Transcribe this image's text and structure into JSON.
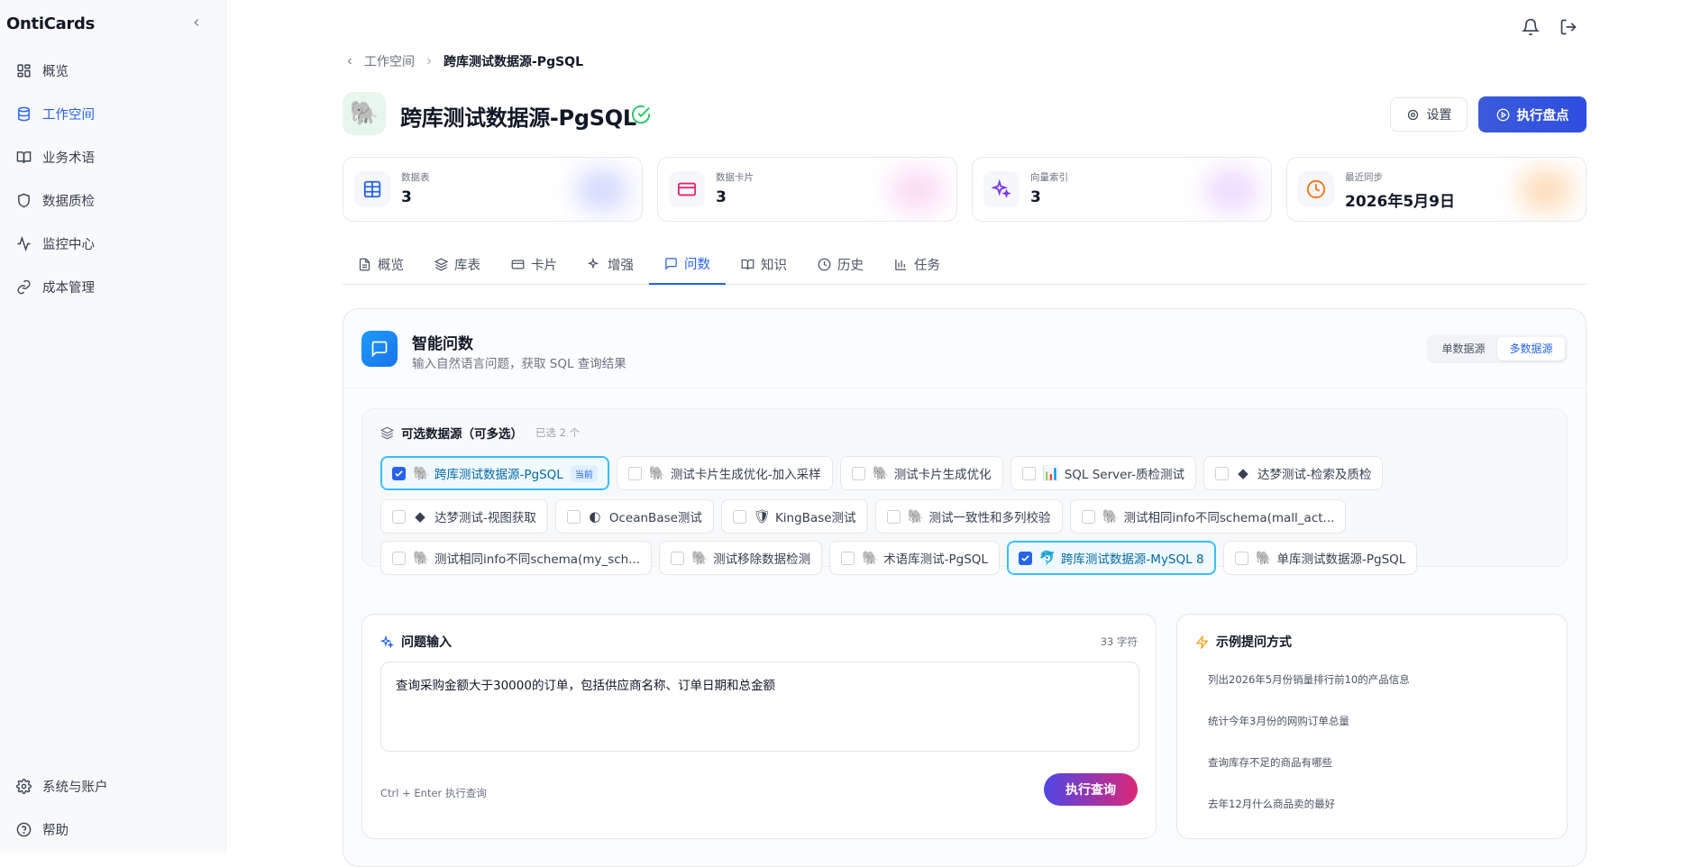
{
  "app": {
    "brand": "OntiCards"
  },
  "sidebar": {
    "items": [
      {
        "label": "概览",
        "icon": "grid-icon"
      },
      {
        "label": "工作空间",
        "icon": "database-icon",
        "active": true
      },
      {
        "label": "业务术语",
        "icon": "book-icon"
      },
      {
        "label": "数据质检",
        "icon": "shield-icon"
      },
      {
        "label": "监控中心",
        "icon": "activity-icon"
      },
      {
        "label": "成本管理",
        "icon": "link-icon"
      }
    ],
    "bottom": [
      {
        "label": "系统与账户",
        "icon": "gear-icon"
      },
      {
        "label": "帮助",
        "icon": "help-icon"
      }
    ]
  },
  "breadcrumb": {
    "parent": "工作空间",
    "current": "跨库测试数据源-PgSQL"
  },
  "header": {
    "title": "跨库测试数据源-PgSQL",
    "settings_label": "设置",
    "run_label": "执行盘点"
  },
  "stats": [
    {
      "label": "数据表",
      "value": "3",
      "color": "#2563eb",
      "icon": "table-icon"
    },
    {
      "label": "数据卡片",
      "value": "3",
      "color": "#db2777",
      "icon": "card-icon"
    },
    {
      "label": "向量索引",
      "value": "3",
      "color": "#7c3aed",
      "icon": "sparkle-icon"
    },
    {
      "label": "最近同步",
      "value": "2026年5月9日",
      "color": "#f97316",
      "icon": "clock-icon"
    }
  ],
  "tabs": [
    {
      "label": "概览",
      "icon": "file-icon"
    },
    {
      "label": "库表",
      "icon": "layers-icon"
    },
    {
      "label": "卡片",
      "icon": "card-icon"
    },
    {
      "label": "增强",
      "icon": "sparkle-icon"
    },
    {
      "label": "问数",
      "icon": "chat-icon",
      "active": true
    },
    {
      "label": "知识",
      "icon": "book-icon"
    },
    {
      "label": "历史",
      "icon": "clock-icon"
    },
    {
      "label": "任务",
      "icon": "chart-icon"
    }
  ],
  "ask": {
    "title": "智能问数",
    "subtitle": "输入自然语言问题，获取 SQL 查询结果",
    "mode_single": "单数据源",
    "mode_multi": "多数据源",
    "sources_title": "可选数据源（可多选）",
    "sources_count": "已选 2 个",
    "current_tag": "当前",
    "sources": [
      [
        {
          "label": "跨库测试数据源-PgSQL",
          "selected": true,
          "current": true,
          "icon": "🐘"
        },
        {
          "label": "测试卡片生成优化-加入采样",
          "icon": "🐘"
        },
        {
          "label": "测试卡片生成优化",
          "icon": "🐘"
        },
        {
          "label": "SQL Server-质检测试",
          "icon": "📊"
        },
        {
          "label": "达梦测试-检索及质检",
          "icon": "◆"
        }
      ],
      [
        {
          "label": "达梦测试-视图获取",
          "icon": "◆"
        },
        {
          "label": "OceanBase测试",
          "icon": "◐"
        },
        {
          "label": "KingBase测试",
          "icon": "🛡"
        },
        {
          "label": "测试一致性和多列校验",
          "icon": "🐘"
        },
        {
          "label": "测试相同info不同schema(mall_act...",
          "icon": "🐘"
        }
      ],
      [
        {
          "label": "测试相同info不同schema(my_sch...",
          "icon": "🐘"
        },
        {
          "label": "测试移除数据检测",
          "icon": "🐘"
        },
        {
          "label": "术语库测试-PgSQL",
          "icon": "🐘"
        },
        {
          "label": "跨库测试数据源-MySQL 8",
          "selected": true,
          "icon": "🐬"
        },
        {
          "label": "单库测试数据源-PgSQL",
          "icon": "🐘"
        }
      ]
    ],
    "question_title": "问题输入",
    "char_count": "33 字符",
    "question": "查询采购金额大于30000的订单，包括供应商名称、订单日期和总金额",
    "hint": "Ctrl + Enter 执行查询",
    "execute_label": "执行查询",
    "examples_title": "示例提问方式",
    "examples": [
      "列出2026年5月份销量排行前10的产品信息",
      "统计今年3月份的网购订单总量",
      "查询库存不足的商品有哪些",
      "去年12月什么商品卖的最好"
    ]
  }
}
